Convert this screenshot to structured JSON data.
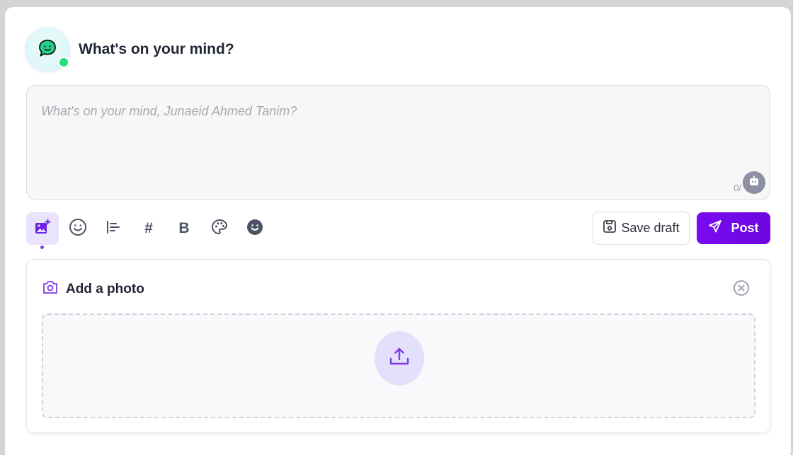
{
  "header": {
    "title": "What's on your mind?",
    "avatar_icon": "chat-bubble-smile-icon",
    "status": "online"
  },
  "composer": {
    "placeholder": "What's on your mind, Junaeid Ahmed Tanim?",
    "char_count": "0/",
    "assistant_icon": "robot-icon"
  },
  "toolbar": {
    "tools": [
      {
        "name": "add-image",
        "icon": "image-plus-icon",
        "active": true
      },
      {
        "name": "emoji",
        "icon": "smiley-icon"
      },
      {
        "name": "align",
        "icon": "align-left-icon"
      },
      {
        "name": "hashtag",
        "icon": "hash-icon",
        "text": "#"
      },
      {
        "name": "bold",
        "icon": "bold-icon",
        "text": "B"
      },
      {
        "name": "color",
        "icon": "palette-icon"
      },
      {
        "name": "sticker",
        "icon": "sticker-icon"
      }
    ],
    "save_draft_label": "Save draft",
    "post_label": "Post"
  },
  "photo_panel": {
    "title": "Add a photo",
    "camera_icon": "camera-icon",
    "close_icon": "close-circle-icon",
    "upload_icon": "upload-icon"
  },
  "colors": {
    "accent": "#7a0bf2",
    "accent_light": "#e9e4fb",
    "online": "#22e07a"
  }
}
